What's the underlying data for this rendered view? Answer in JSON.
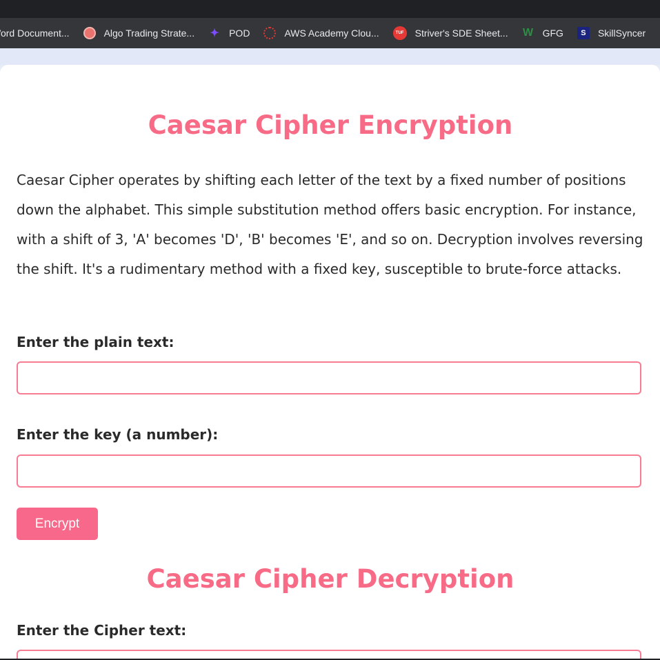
{
  "bookmarks": [
    {
      "label": "Word Document...",
      "icon": "document-icon"
    },
    {
      "label": "Algo Trading Strate...",
      "icon": "brain-icon"
    },
    {
      "label": "POD",
      "icon": "pod-icon"
    },
    {
      "label": "AWS Academy Clou...",
      "icon": "aws-academy-icon"
    },
    {
      "label": "Striver's SDE Sheet...",
      "icon": "tuf-icon"
    },
    {
      "label": "GFG",
      "icon": "gfg-icon"
    },
    {
      "label": "SkillSyncer",
      "icon": "skillsyncer-icon"
    }
  ],
  "encryption": {
    "title": "Caesar Cipher Encryption",
    "description": "Caesar Cipher operates by shifting each letter of the text by a fixed number of positions down the alphabet. This simple substitution method offers basic encryption. For instance, with a shift of 3, 'A' becomes 'D', 'B' becomes 'E', and so on. Decryption involves reversing the shift. It's a rudimentary method with a fixed key, susceptible to brute-force attacks.",
    "plain_label": "Enter the plain text:",
    "plain_value": "",
    "key_label": "Enter the key (a number):",
    "key_value": "",
    "button_label": "Encrypt"
  },
  "decryption": {
    "title": "Caesar Cipher Decryption",
    "cipher_label": "Enter the Cipher text:",
    "cipher_value": ""
  },
  "colors": {
    "accent": "#f76b87",
    "button": "#f7688a",
    "border": "#f77b93"
  }
}
